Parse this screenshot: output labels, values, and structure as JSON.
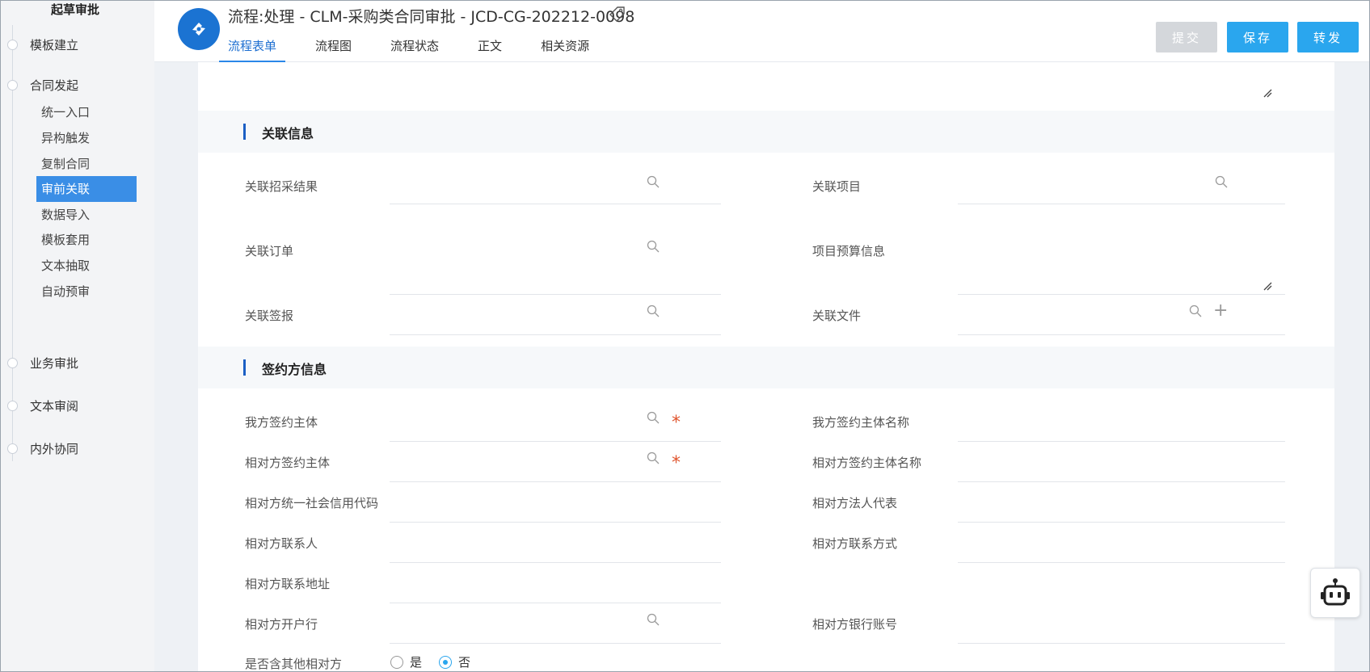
{
  "sidebar": {
    "title": "起草审批",
    "steps": [
      {
        "label": "模板建立"
      },
      {
        "label": "合同发起"
      },
      {
        "label": "业务审批"
      },
      {
        "label": "文本审阅"
      },
      {
        "label": "内外协同"
      }
    ],
    "subitems": [
      {
        "label": "统一入口"
      },
      {
        "label": "异构触发"
      },
      {
        "label": "复制合同"
      },
      {
        "label": "审前关联",
        "active": true
      },
      {
        "label": "数据导入"
      },
      {
        "label": "模板套用"
      },
      {
        "label": "文本抽取"
      },
      {
        "label": "自动预审"
      }
    ]
  },
  "header": {
    "title": "流程:处理 - CLM-采购类合同审批 - JCD-CG-202212-0098",
    "tabs": [
      {
        "label": "流程表单",
        "active": true
      },
      {
        "label": "流程图"
      },
      {
        "label": "流程状态"
      },
      {
        "label": "正文"
      },
      {
        "label": "相关资源"
      }
    ],
    "buttons": {
      "submit": "提交",
      "save": "保存",
      "forward": "转发"
    }
  },
  "sections": {
    "related": {
      "title": "关联信息",
      "fields": {
        "bid_result": "关联招采结果",
        "project": "关联项目",
        "order": "关联订单",
        "budget": "项目预算信息",
        "sign_report": "关联签报",
        "file": "关联文件"
      }
    },
    "parties": {
      "title": "签约方信息",
      "fields": {
        "our_entity": "我方签约主体",
        "our_entity_name": "我方签约主体名称",
        "cp_entity": "相对方签约主体",
        "cp_entity_name": "相对方签约主体名称",
        "cp_credit_code": "相对方统一社会信用代码",
        "cp_legal_rep": "相对方法人代表",
        "cp_contact": "相对方联系人",
        "cp_contact_method": "相对方联系方式",
        "cp_address": "相对方联系地址",
        "cp_bank": "相对方开户行",
        "cp_bank_account": "相对方银行账号",
        "other_cp": "是否含其他相对方"
      },
      "other_cp_options": {
        "yes": "是",
        "no": "否",
        "selected": "no"
      }
    }
  },
  "colors": {
    "accent": "#2aa6ee",
    "active_nav": "#3a8ee6",
    "required": "#e0552e",
    "section_bar": "#1b5fc4"
  }
}
